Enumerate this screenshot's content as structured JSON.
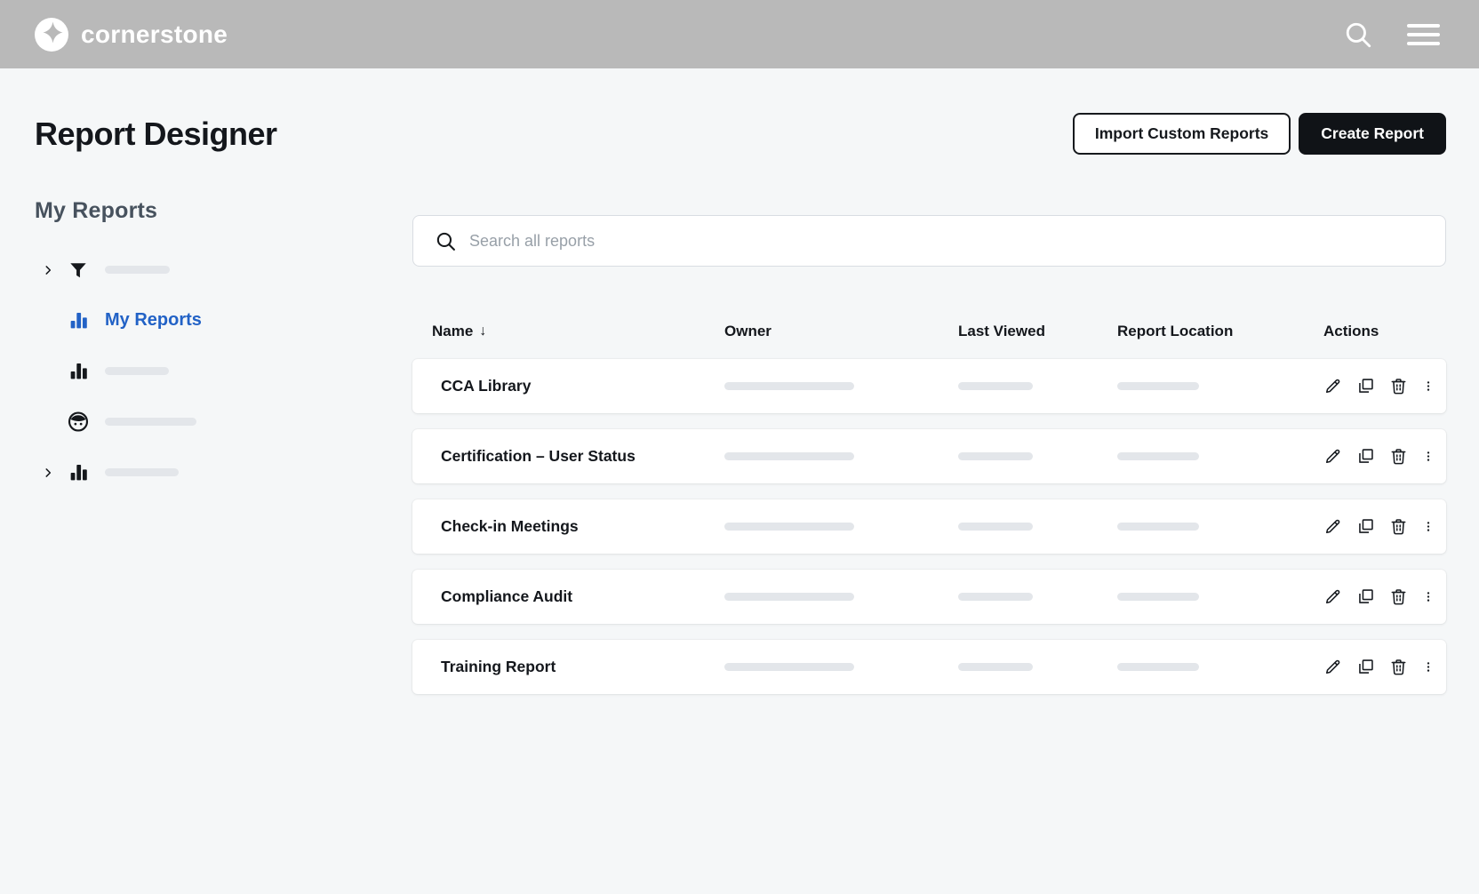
{
  "topbar": {
    "brand": "cornerstone"
  },
  "header": {
    "title": "Report Designer",
    "import_button": "Import Custom Reports",
    "create_button": "Create Report"
  },
  "sidebar": {
    "heading": "My Reports",
    "items": [
      {
        "icon": "filter",
        "label": "",
        "expandable": true,
        "placeholder": true
      },
      {
        "icon": "bar-chart",
        "label": "My Reports",
        "selected": true
      },
      {
        "icon": "bar-chart",
        "label": "",
        "placeholder": true
      },
      {
        "icon": "face",
        "label": "",
        "placeholder": true
      },
      {
        "icon": "bar-chart",
        "label": "",
        "expandable": true,
        "placeholder": true
      }
    ]
  },
  "search": {
    "placeholder": "Search all reports"
  },
  "table": {
    "columns": [
      {
        "label": "Name"
      },
      {
        "label": "Owner"
      },
      {
        "label": "Last Viewed"
      },
      {
        "label": "Report Location"
      },
      {
        "label": "Actions"
      }
    ],
    "sort": {
      "column": "Name",
      "direction": "descending",
      "arrow": "↓"
    },
    "rows": [
      {
        "name": "CCA Library"
      },
      {
        "name": "Certification – User Status"
      },
      {
        "name": "Check-in Meetings"
      },
      {
        "name": "Compliance Audit"
      },
      {
        "name": "Training Report"
      }
    ],
    "row_actions": [
      "edit",
      "duplicate",
      "delete",
      "more"
    ]
  },
  "colors": {
    "topbar_bg": "#b9b9b9",
    "page_bg": "#f5f7f8",
    "accent_blue": "#2262c6",
    "text_dark": "#15181c",
    "pill_gray": "#e3e6ea"
  }
}
